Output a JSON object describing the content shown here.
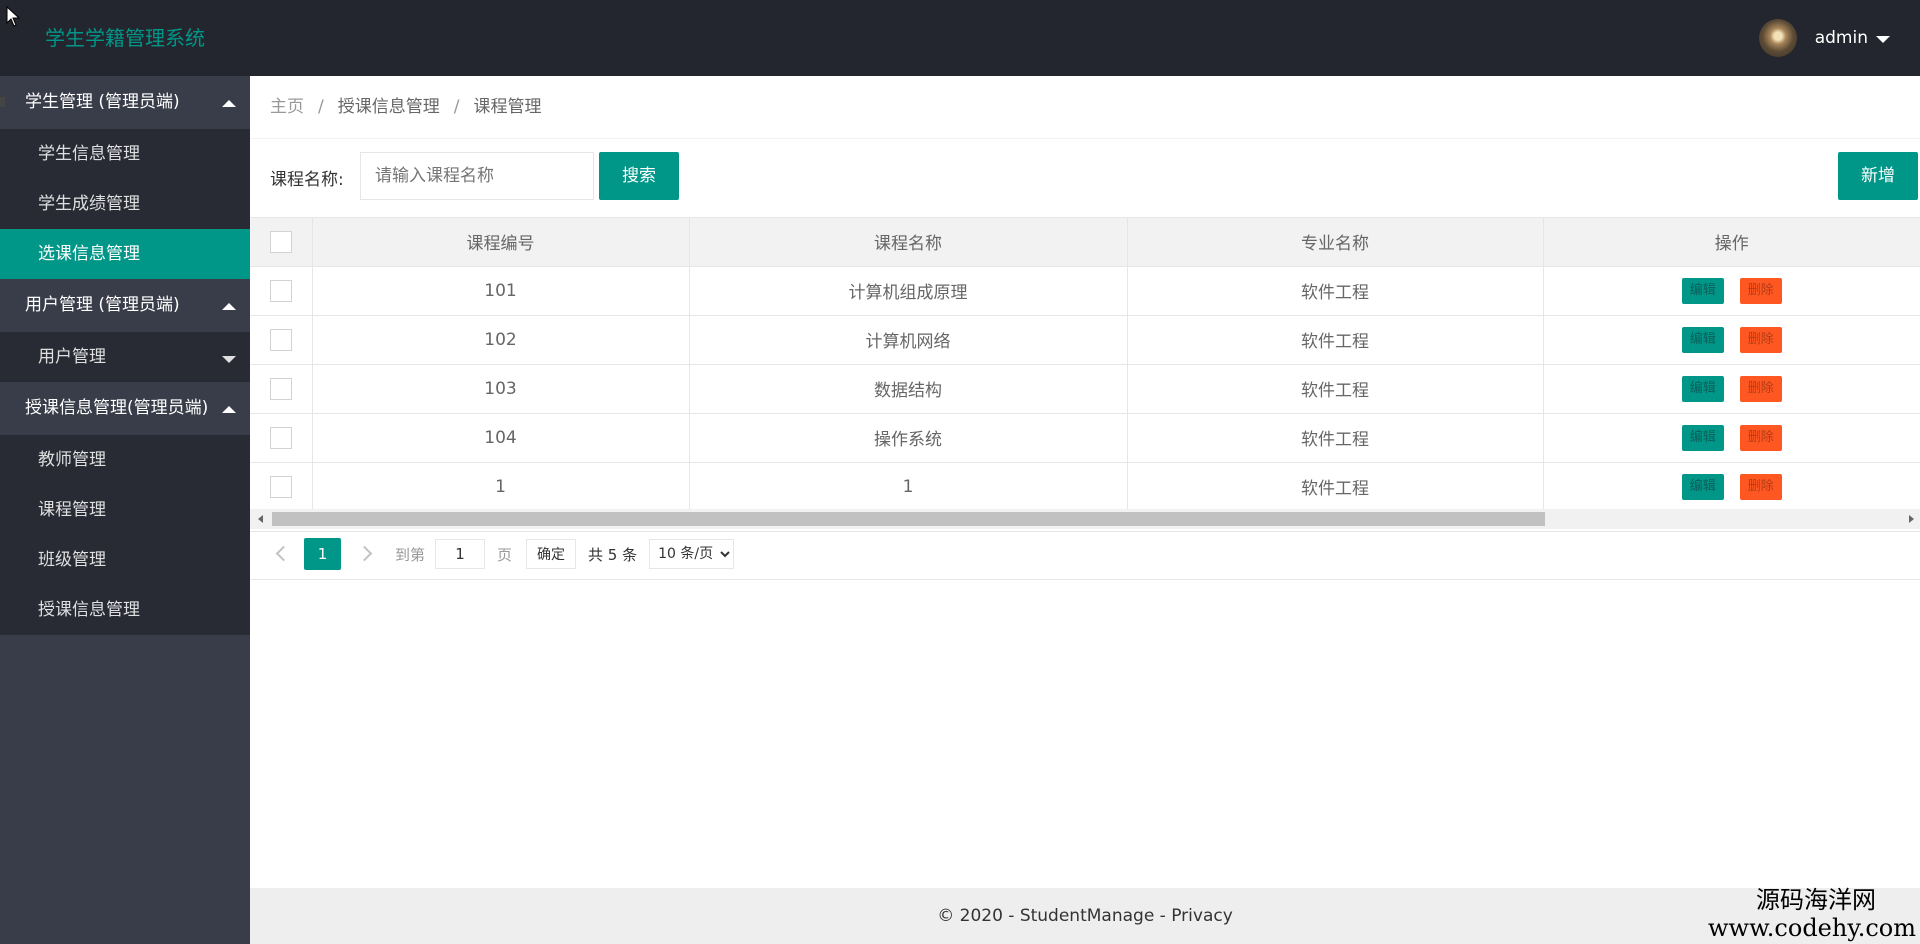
{
  "header": {
    "logo": "学生学籍管理系统",
    "user_name": "admin"
  },
  "sidebar": {
    "groups": [
      {
        "title": "学生管理 (管理员端)",
        "items": [
          "学生信息管理",
          "学生成绩管理",
          "选课信息管理"
        ]
      },
      {
        "title": "用户管理 (管理员端)",
        "items": [
          "用户管理"
        ]
      },
      {
        "title": "授课信息管理(管理员端)",
        "items": [
          "教师管理",
          "课程管理",
          "班级管理",
          "授课信息管理"
        ]
      }
    ]
  },
  "breadcrumb": {
    "home": "主页",
    "level1": "授课信息管理",
    "current": "课程管理"
  },
  "search": {
    "label": "课程名称:",
    "placeholder": "请输入课程名称",
    "value": "",
    "search_button": "搜索",
    "add_button": "新增"
  },
  "table": {
    "headers": [
      "课程编号",
      "课程名称",
      "专业名称",
      "操作"
    ],
    "rows": [
      {
        "id": "101",
        "name": "计算机组成原理",
        "major": "软件工程"
      },
      {
        "id": "102",
        "name": "计算机网络",
        "major": "软件工程"
      },
      {
        "id": "103",
        "name": "数据结构",
        "major": "软件工程"
      },
      {
        "id": "104",
        "name": "操作系统",
        "major": "软件工程"
      },
      {
        "id": "1",
        "name": "1",
        "major": "软件工程"
      }
    ],
    "edit_label": "编辑",
    "delete_label": "删除"
  },
  "pager": {
    "current_page": "1",
    "goto_label": "到第",
    "goto_value": "1",
    "page_label": "页",
    "confirm": "确定",
    "total": "共 5 条",
    "page_size": "10 条/页"
  },
  "footer": {
    "copyright": "© 2020 - StudentManage - ",
    "privacy": "Privacy"
  },
  "watermark": {
    "cn": "源码海洋网",
    "url": "www.codehy.com"
  },
  "colors": {
    "primary": "#009688",
    "danger": "#ff5722",
    "header_bg": "#23262e",
    "sidebar_bg": "#393d49"
  }
}
